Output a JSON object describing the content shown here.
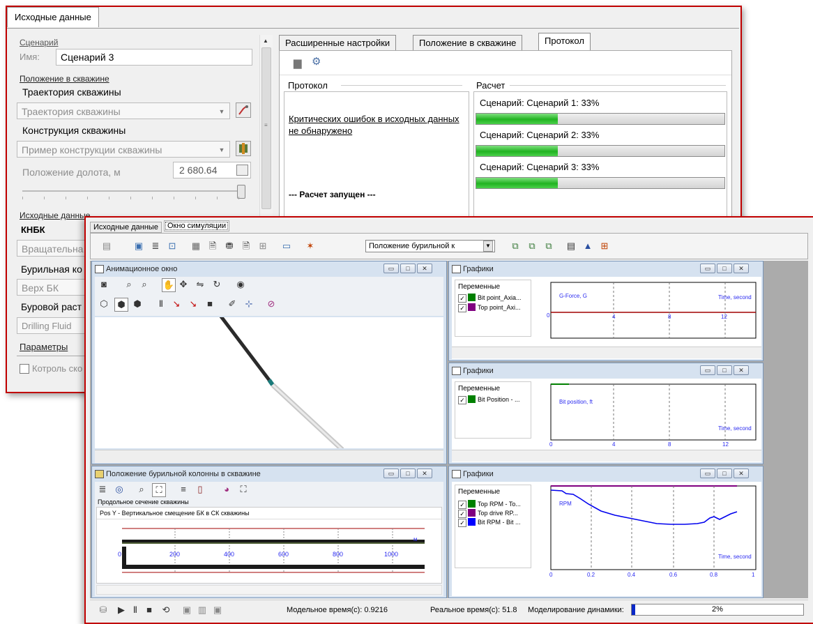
{
  "input_window": {
    "tab": "Исходные данные",
    "sections": {
      "scenario": "Сценарий",
      "position": "Положение в скважине",
      "input": "Исходные данные",
      "params": "Параметры"
    },
    "name_label": "Имя:",
    "name_value": "Сценарий 3",
    "trajectory_label": "Траектория скважины",
    "trajectory_value": "Траектория скважины",
    "construction_label": "Конструкция скважины",
    "construction_value": "Пример конструкции скважины",
    "bit_pos_label": "Положение долота, м",
    "bit_pos_value": "2 680.64",
    "knbk_label": "КНБК",
    "knbk_value": "Вращательна",
    "drill_col_label": "Бурильная ко",
    "drill_col_value": "Верх БК",
    "fluid_label": "Буровой раст",
    "fluid_value": "Drilling Fluid",
    "control_label": "Котроль ско",
    "right_tabs": [
      "Расширенные настройки",
      "Положение в скважине",
      "Протокол"
    ],
    "protocol_header": "Протокол",
    "calc_header": "Расчет",
    "protocol_text": "Критических ошибок в исходных данных не обнаружено",
    "run_text": "--- Расчет запущен ---",
    "scenarios": [
      {
        "label": "Сценарий: Сценарий 1: 33%",
        "progress": 0.33
      },
      {
        "label": "Сценарий: Сценарий 2: 33%",
        "progress": 0.33
      },
      {
        "label": "Сценарий: Сценарий 3: 33%",
        "progress": 0.33
      }
    ]
  },
  "sim_window": {
    "tabs": [
      "Исходные данные",
      "Окно симуляции"
    ],
    "toolbar_combo": "Положение бурильной к",
    "anim_title": "Анимационное окно",
    "well_title": "Положение бурильной колонны в скважине",
    "well_section": "Продольное сечение скважины",
    "well_posy": "Pos Y - Вертикальное смещение БК в СК скважины",
    "well_axis_unit": "м",
    "well_ticks": [
      "0",
      "200",
      "400",
      "600",
      "800",
      "1000"
    ],
    "graphs_title": "Графики",
    "variables_header": "Переменные",
    "graph1": {
      "variables": [
        {
          "name": "Bit point_Axia...",
          "color": "#008000"
        },
        {
          "name": "Top point_Axi...",
          "color": "#800080"
        }
      ],
      "ylabel": "G-Force, G",
      "xlabel": "Time, second",
      "xticks": [
        "0",
        "4",
        "8",
        "12"
      ]
    },
    "graph2": {
      "variables": [
        {
          "name": "Bit Position - ...",
          "color": "#008000"
        }
      ],
      "ylabel": "Bit position, ft",
      "xlabel": "Time, second",
      "xticks": [
        "0",
        "4",
        "8",
        "12"
      ]
    },
    "graph3": {
      "variables": [
        {
          "name": "Top RPM - To...",
          "color": "#008000"
        },
        {
          "name": "Top drive RP...",
          "color": "#800080"
        },
        {
          "name": "Bit RPM - Bit ...",
          "color": "#0000ff"
        }
      ],
      "ylabel": "RPM",
      "xlabel": "Time, second",
      "xticks": [
        "0",
        "0.2",
        "0.4",
        "0.6",
        "0.8",
        "1"
      ]
    },
    "status": {
      "model_time": "Модельное время(с): 0.9216",
      "real_time": "Реальное время(с): 51.8",
      "dyn_label": "Моделирование динамики:",
      "dyn_value": "2%",
      "dyn_progress": 0.02
    }
  }
}
